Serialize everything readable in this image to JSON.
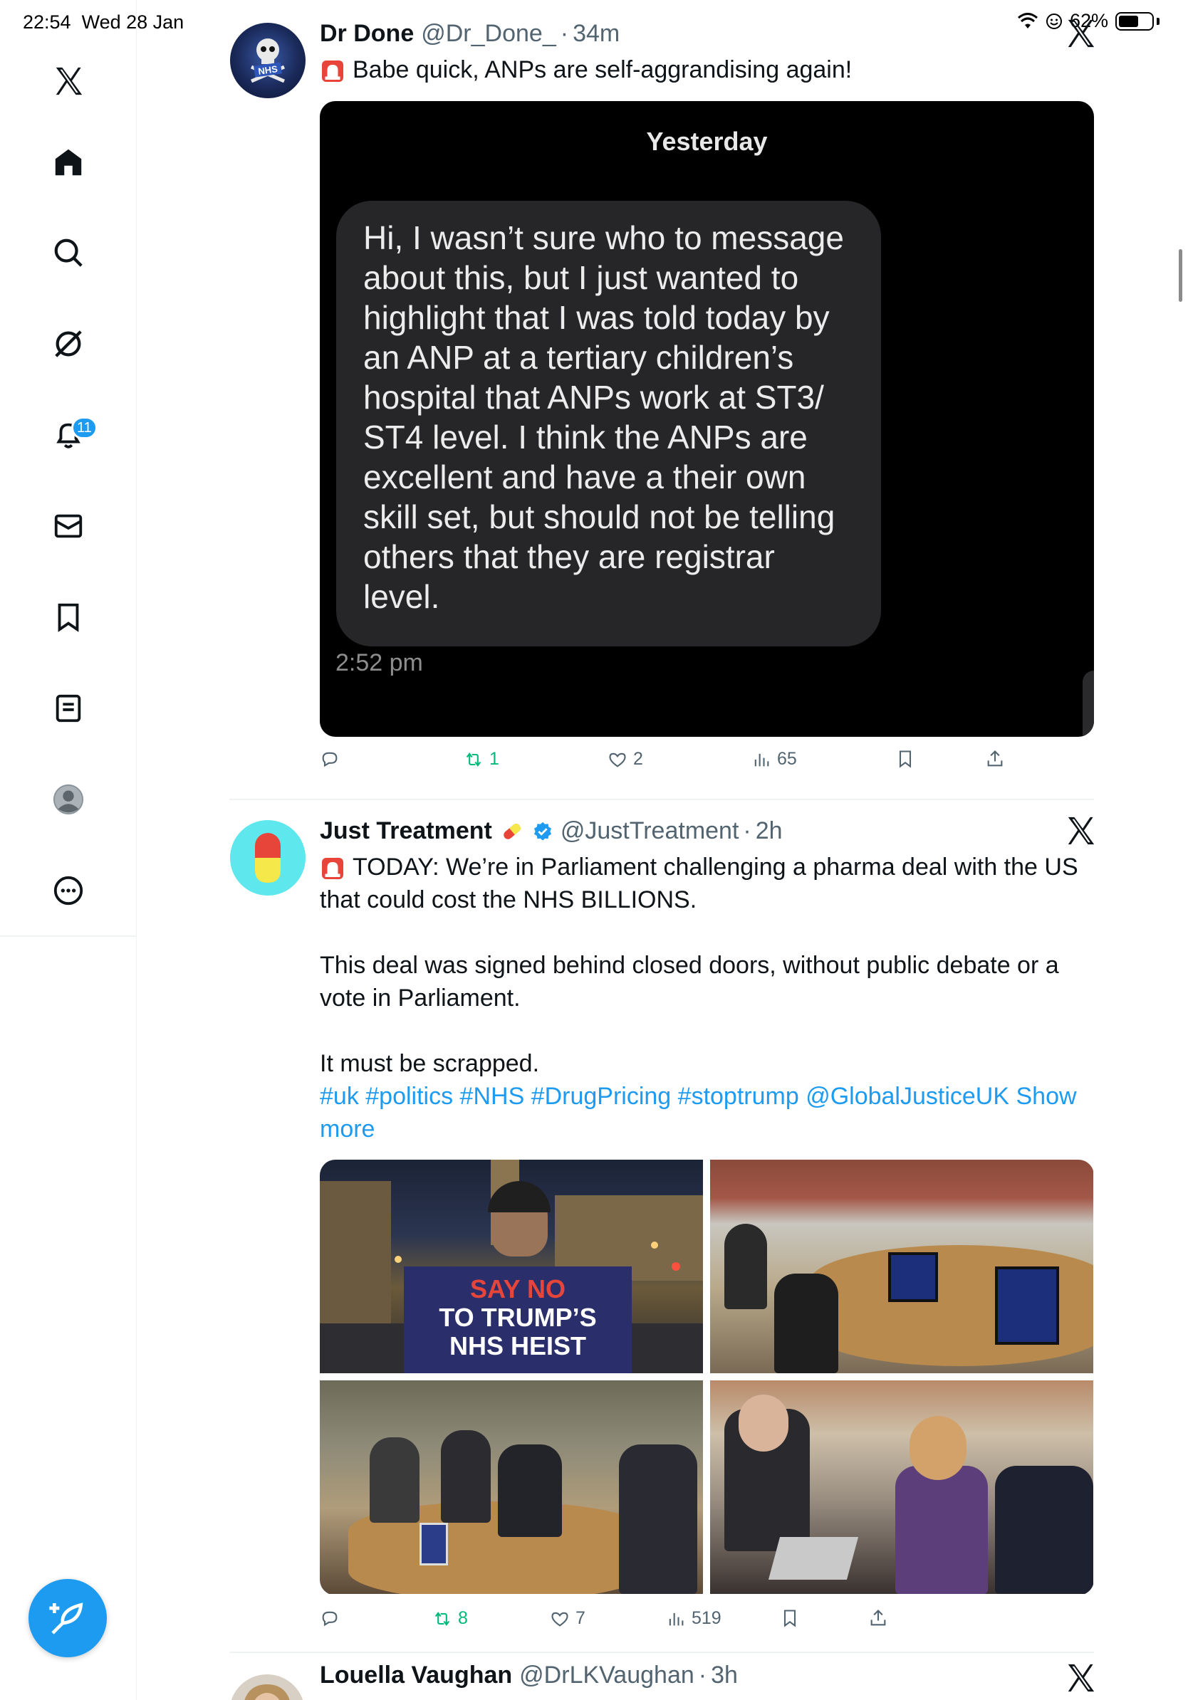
{
  "status_bar": {
    "time": "22:54",
    "date": "Wed 28 Jan",
    "battery": "62%"
  },
  "sidebar": {
    "items": [
      {
        "name": "logo",
        "icon": "x-logo-icon"
      },
      {
        "name": "home",
        "icon": "home-icon"
      },
      {
        "name": "explore",
        "icon": "search-icon"
      },
      {
        "name": "grok",
        "icon": "grok-icon"
      },
      {
        "name": "notifications",
        "icon": "bell-icon",
        "badge": "11"
      },
      {
        "name": "messages",
        "icon": "mail-icon"
      },
      {
        "name": "bookmarks",
        "icon": "bookmark-icon"
      },
      {
        "name": "lists",
        "icon": "list-icon"
      },
      {
        "name": "profile",
        "icon": "profile-icon"
      },
      {
        "name": "more",
        "icon": "more-icon"
      }
    ],
    "compose_icon": "compose-feather-icon"
  },
  "tweets": [
    {
      "display_name": "Dr Done",
      "handle": "@Dr_Done_",
      "time": "34m",
      "emoji": "🚨",
      "text": "Babe quick, ANPs are self-aggrandising again!",
      "media": {
        "day_label": "Yesterday",
        "message": "Hi, I wasn’t sure who to message about this, but I just wanted to highlight that I was told today by an ANP at a tertiary children’s hospital that ANPs work at ST3/ ST4 level. I think the ANPs are excellent and have a their own skill set, but should not be telling others that they are registrar level.",
        "message_time": "2:52 pm"
      },
      "actions": {
        "replies": "",
        "reposts": "1",
        "likes": "2",
        "views": "65"
      }
    },
    {
      "display_name": "Just Treatment",
      "handle": "@JustTreatment",
      "time": "2h",
      "emoji": "🚨",
      "text_line1": "TODAY: We’re in Parliament challenging a pharma deal with the US that could cost the NHS BILLIONS.",
      "text_para2": "This deal was signed behind closed doors, without public debate or a vote in Parliament.",
      "text_para3": "It must be scrapped.",
      "hashtags": "#uk #politics #NHS #DrugPricing #stoptrump @GlobalJusticeUK Show more",
      "photos": {
        "sign_line1": "SAY NO",
        "sign_line2": "TO TRUMP’S",
        "sign_line3": "NHS HEIST"
      },
      "actions": {
        "replies": "",
        "reposts": "8",
        "likes": "7",
        "views": "519"
      }
    },
    {
      "display_name": "Louella Vaughan",
      "handle": "@DrLKVaughan",
      "time": "3h"
    }
  ],
  "colors": {
    "accent": "#1d9bf0",
    "repost_green": "#00ba7c",
    "muted": "#536471"
  }
}
